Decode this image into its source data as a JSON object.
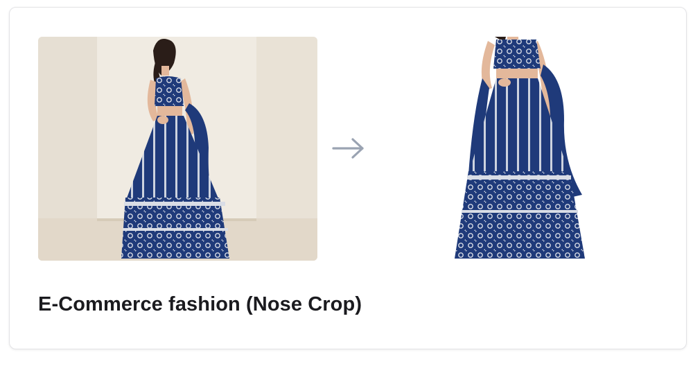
{
  "card": {
    "caption": "E-Commerce fashion (Nose Crop)",
    "arrow_icon": "arrow-right-icon",
    "before_image": "model-in-navy-embroidered-lehenga",
    "after_image": "cropped-navy-embroidered-lehenga"
  },
  "colors": {
    "outfit_navy": "#1f3a7a",
    "embroidery": "#d9dde6",
    "backdrop": "#ece6dc",
    "arrow": "#9aa3b2",
    "caption_text": "#1b1b1f",
    "card_border": "#e3e3e6"
  }
}
